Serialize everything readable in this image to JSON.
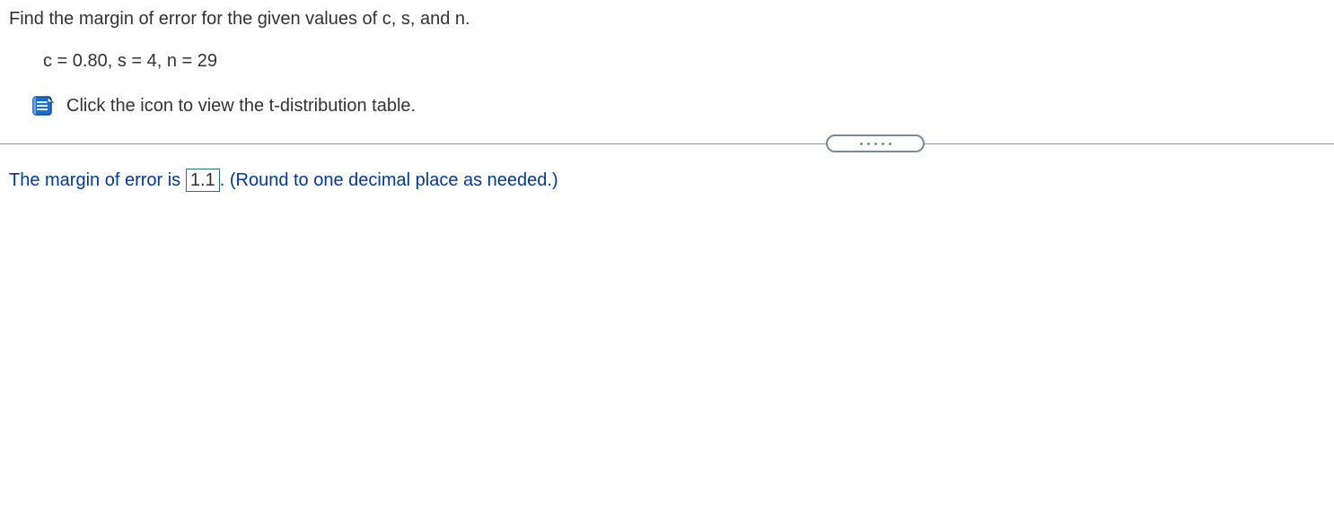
{
  "question": {
    "prompt": "Find the margin of error for the given values of c, s, and n.",
    "params": "c = 0.80, s = 4, n = 29",
    "icon_text": "Click the icon to view the t-distribution table."
  },
  "answer": {
    "lead": "The margin of error is ",
    "value": "1.1",
    "trail": ". (Round to one decimal place as needed.)"
  }
}
